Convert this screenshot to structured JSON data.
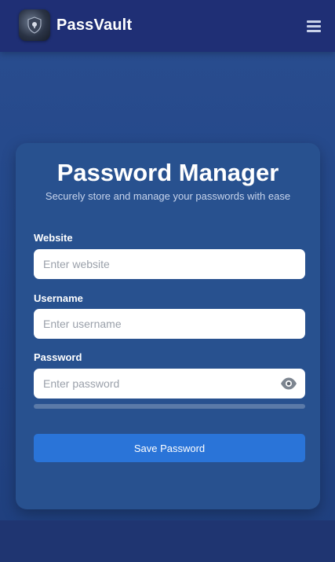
{
  "header": {
    "brand": "PassVault",
    "logo_icon": "vault-shield-icon",
    "menu_icon": "hamburger-menu-icon"
  },
  "card": {
    "title": "Password Manager",
    "subtitle": "Securely store and manage your passwords with ease",
    "fields": {
      "website": {
        "label": "Website",
        "placeholder": "Enter website",
        "value": ""
      },
      "username": {
        "label": "Username",
        "placeholder": "Enter username",
        "value": ""
      },
      "password": {
        "label": "Password",
        "placeholder": "Enter password",
        "value": "",
        "toggle_icon": "eye-icon"
      }
    },
    "password_strength": 0,
    "save_label": "Save Password"
  },
  "colors": {
    "header_bg": "#1f2f75",
    "card_bg": "#28518f",
    "accent": "#2a74d8"
  }
}
